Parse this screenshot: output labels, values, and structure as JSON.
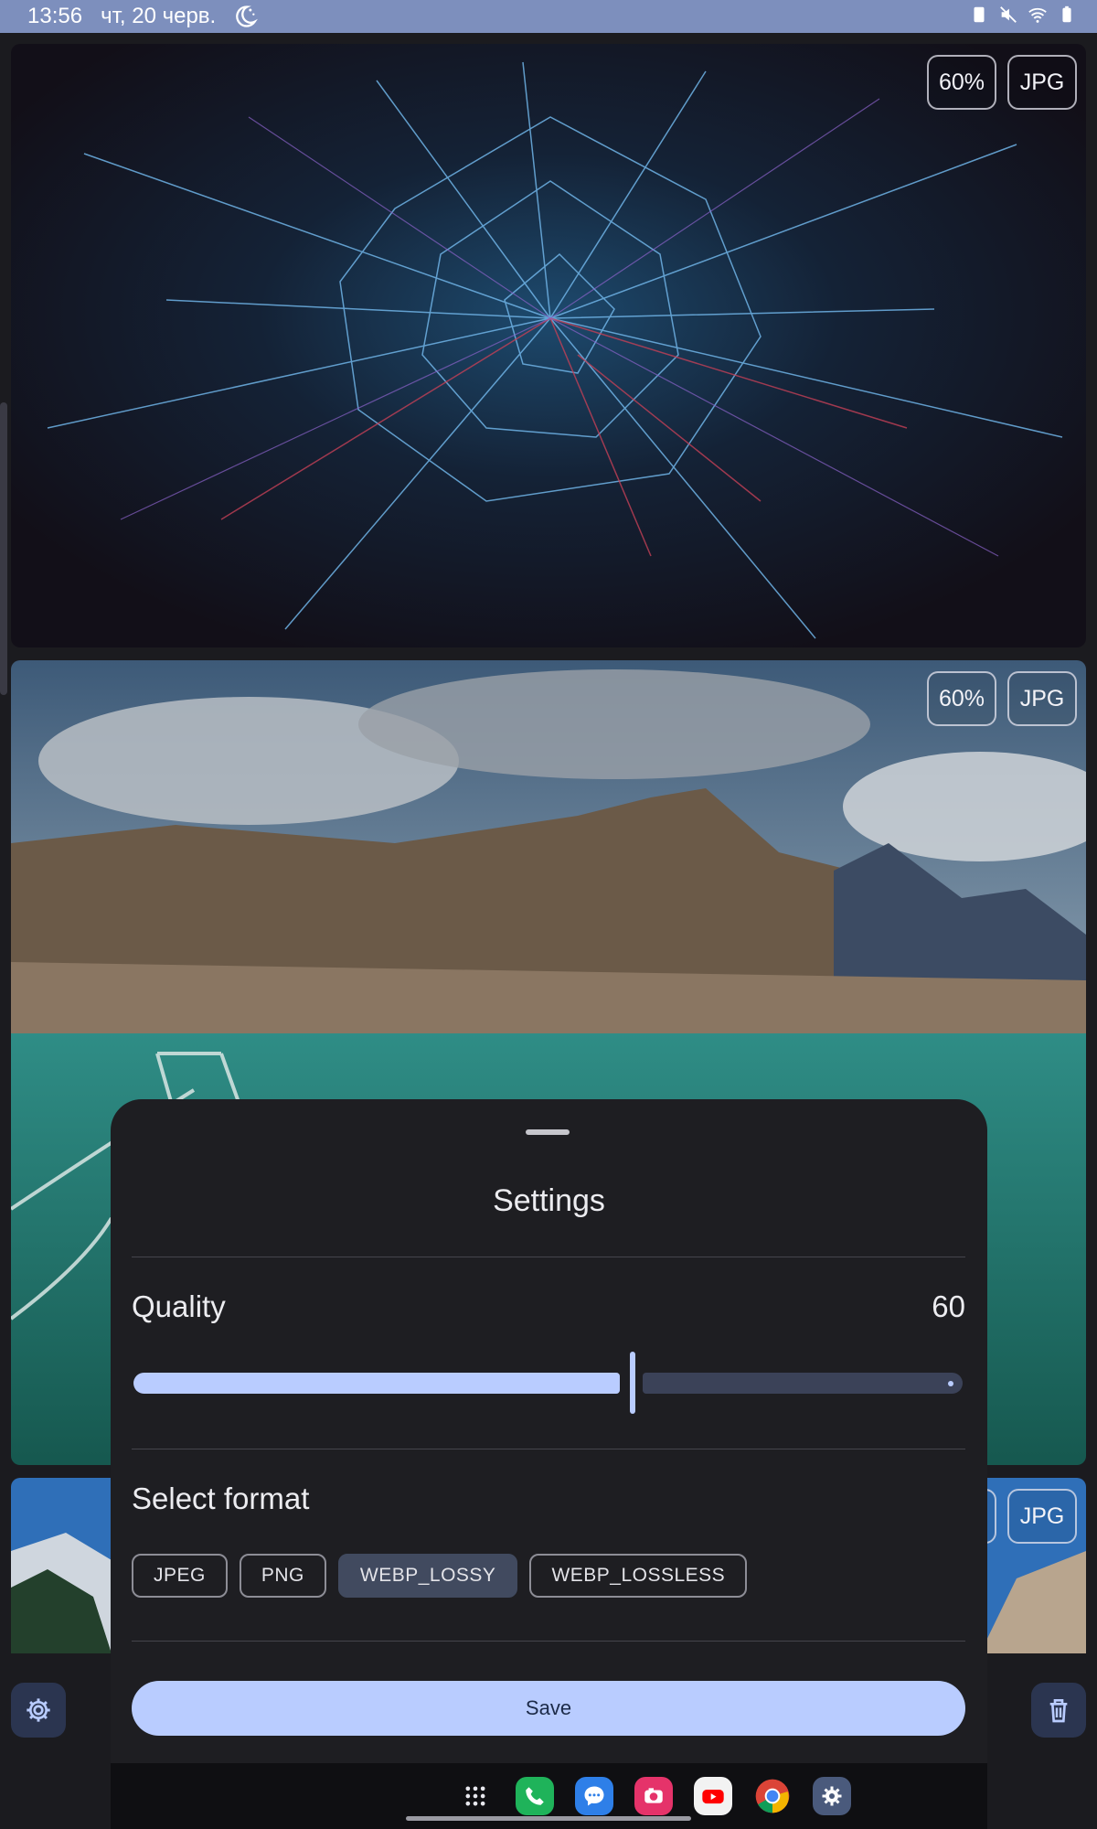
{
  "status_bar": {
    "time": "13:56",
    "date": "чт, 20 черв."
  },
  "images": [
    {
      "quality_badge": "60%",
      "format_badge": "JPG"
    },
    {
      "quality_badge": "60%",
      "format_badge": "JPG"
    },
    {
      "quality_badge": "",
      "format_badge": "JPG"
    }
  ],
  "settings_sheet": {
    "title": "Settings",
    "quality_label": "Quality",
    "quality_value": "60",
    "quality_fraction": 0.6,
    "format_label": "Select format",
    "formats": [
      "JPEG",
      "PNG",
      "WEBP_LOSSY",
      "WEBP_LOSSLESS"
    ],
    "selected_format": "WEBP_LOSSY",
    "save_label": "Save"
  },
  "bottom_bar": {
    "settings_icon": "gear-icon",
    "delete_icon": "trash-icon"
  },
  "dock": {
    "apps": [
      "apps-grid-icon",
      "phone-icon",
      "messages-icon",
      "camera-icon",
      "youtube-icon",
      "chrome-icon",
      "settings-icon"
    ]
  },
  "colors": {
    "accent": "#b9ccff",
    "status_bar": "#7d8fbd",
    "sheet_bg": "#1e1e22",
    "selected_chip": "#414a5f"
  }
}
